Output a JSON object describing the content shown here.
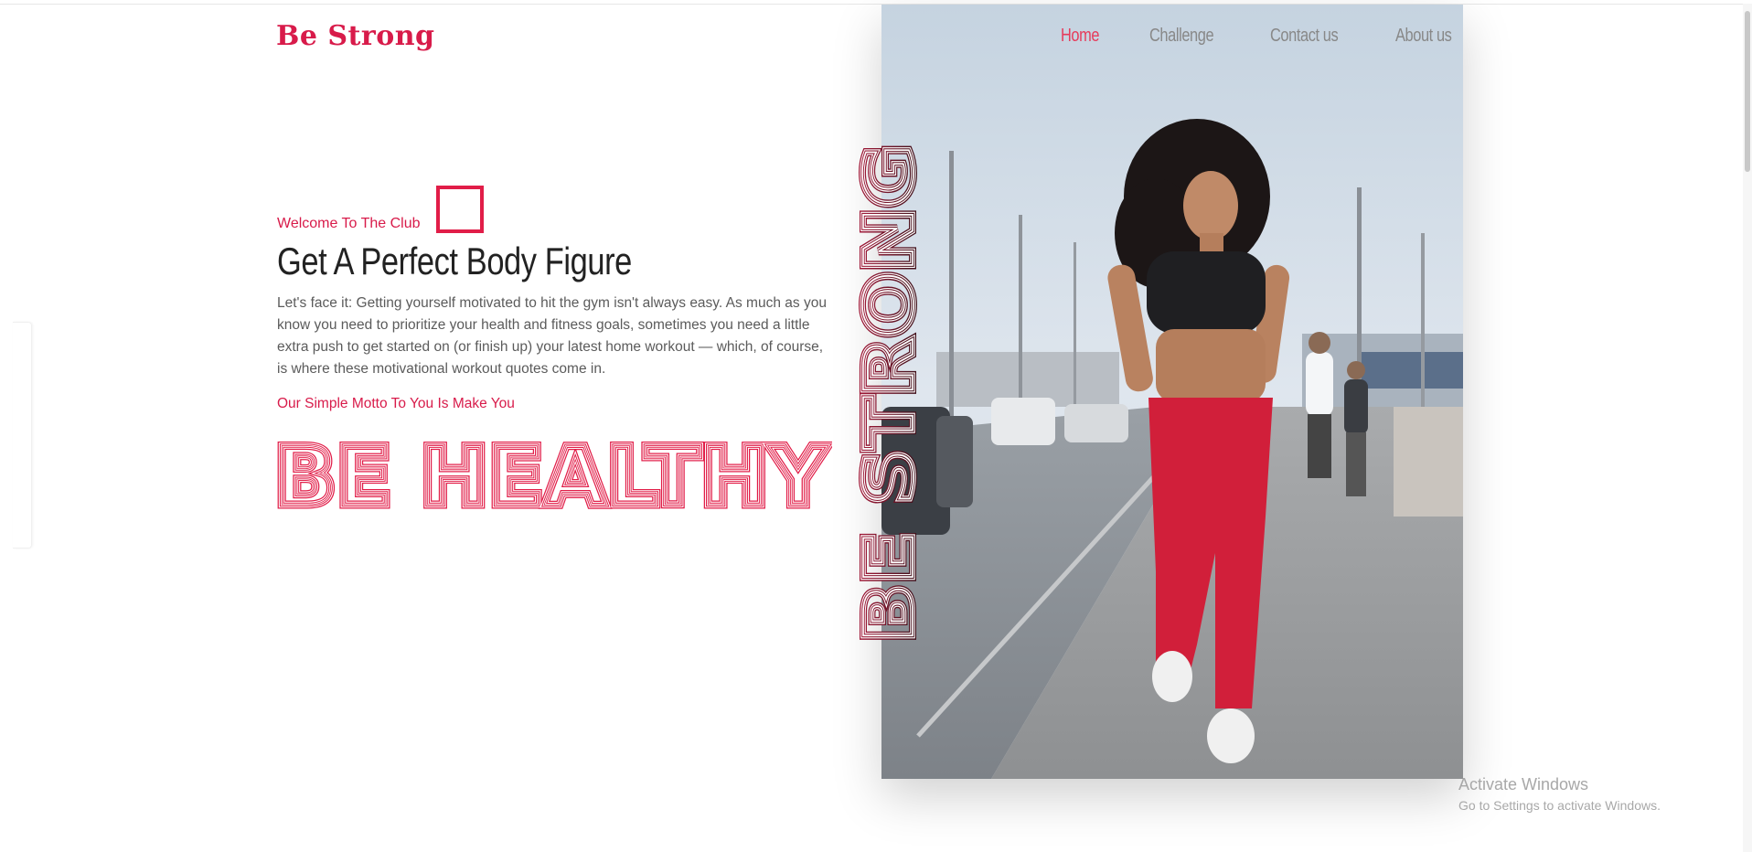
{
  "logo": {
    "text": "Be Strong"
  },
  "nav": {
    "items": [
      {
        "label": "Home",
        "active": true
      },
      {
        "label": "Challenge",
        "active": false
      },
      {
        "label": "Contact us",
        "active": false
      },
      {
        "label": "About us",
        "active": false
      }
    ]
  },
  "hero": {
    "welcome": "Welcome To The Club",
    "headline": "Get A Perfect Body Figure",
    "paragraph": "Let's face it: Getting yourself motivated to hit the gym isn't always easy. As much as you know you need to prioritize your health and fitness goals, sometimes you need a little extra push to get started on (or finish up) your latest home workout — which, of course, is where these motivational workout quotes come in.",
    "motto": "Our Simple Motto To You Is Make You",
    "big_text": "BE HEALTHY",
    "vertical_text": "BE STRONG"
  },
  "colors": {
    "accent": "#e11d48",
    "dark_vertical": "#3a1a22"
  },
  "os_overlay": {
    "title": "Activate Windows",
    "subtitle": "Go to Settings to activate Windows."
  }
}
